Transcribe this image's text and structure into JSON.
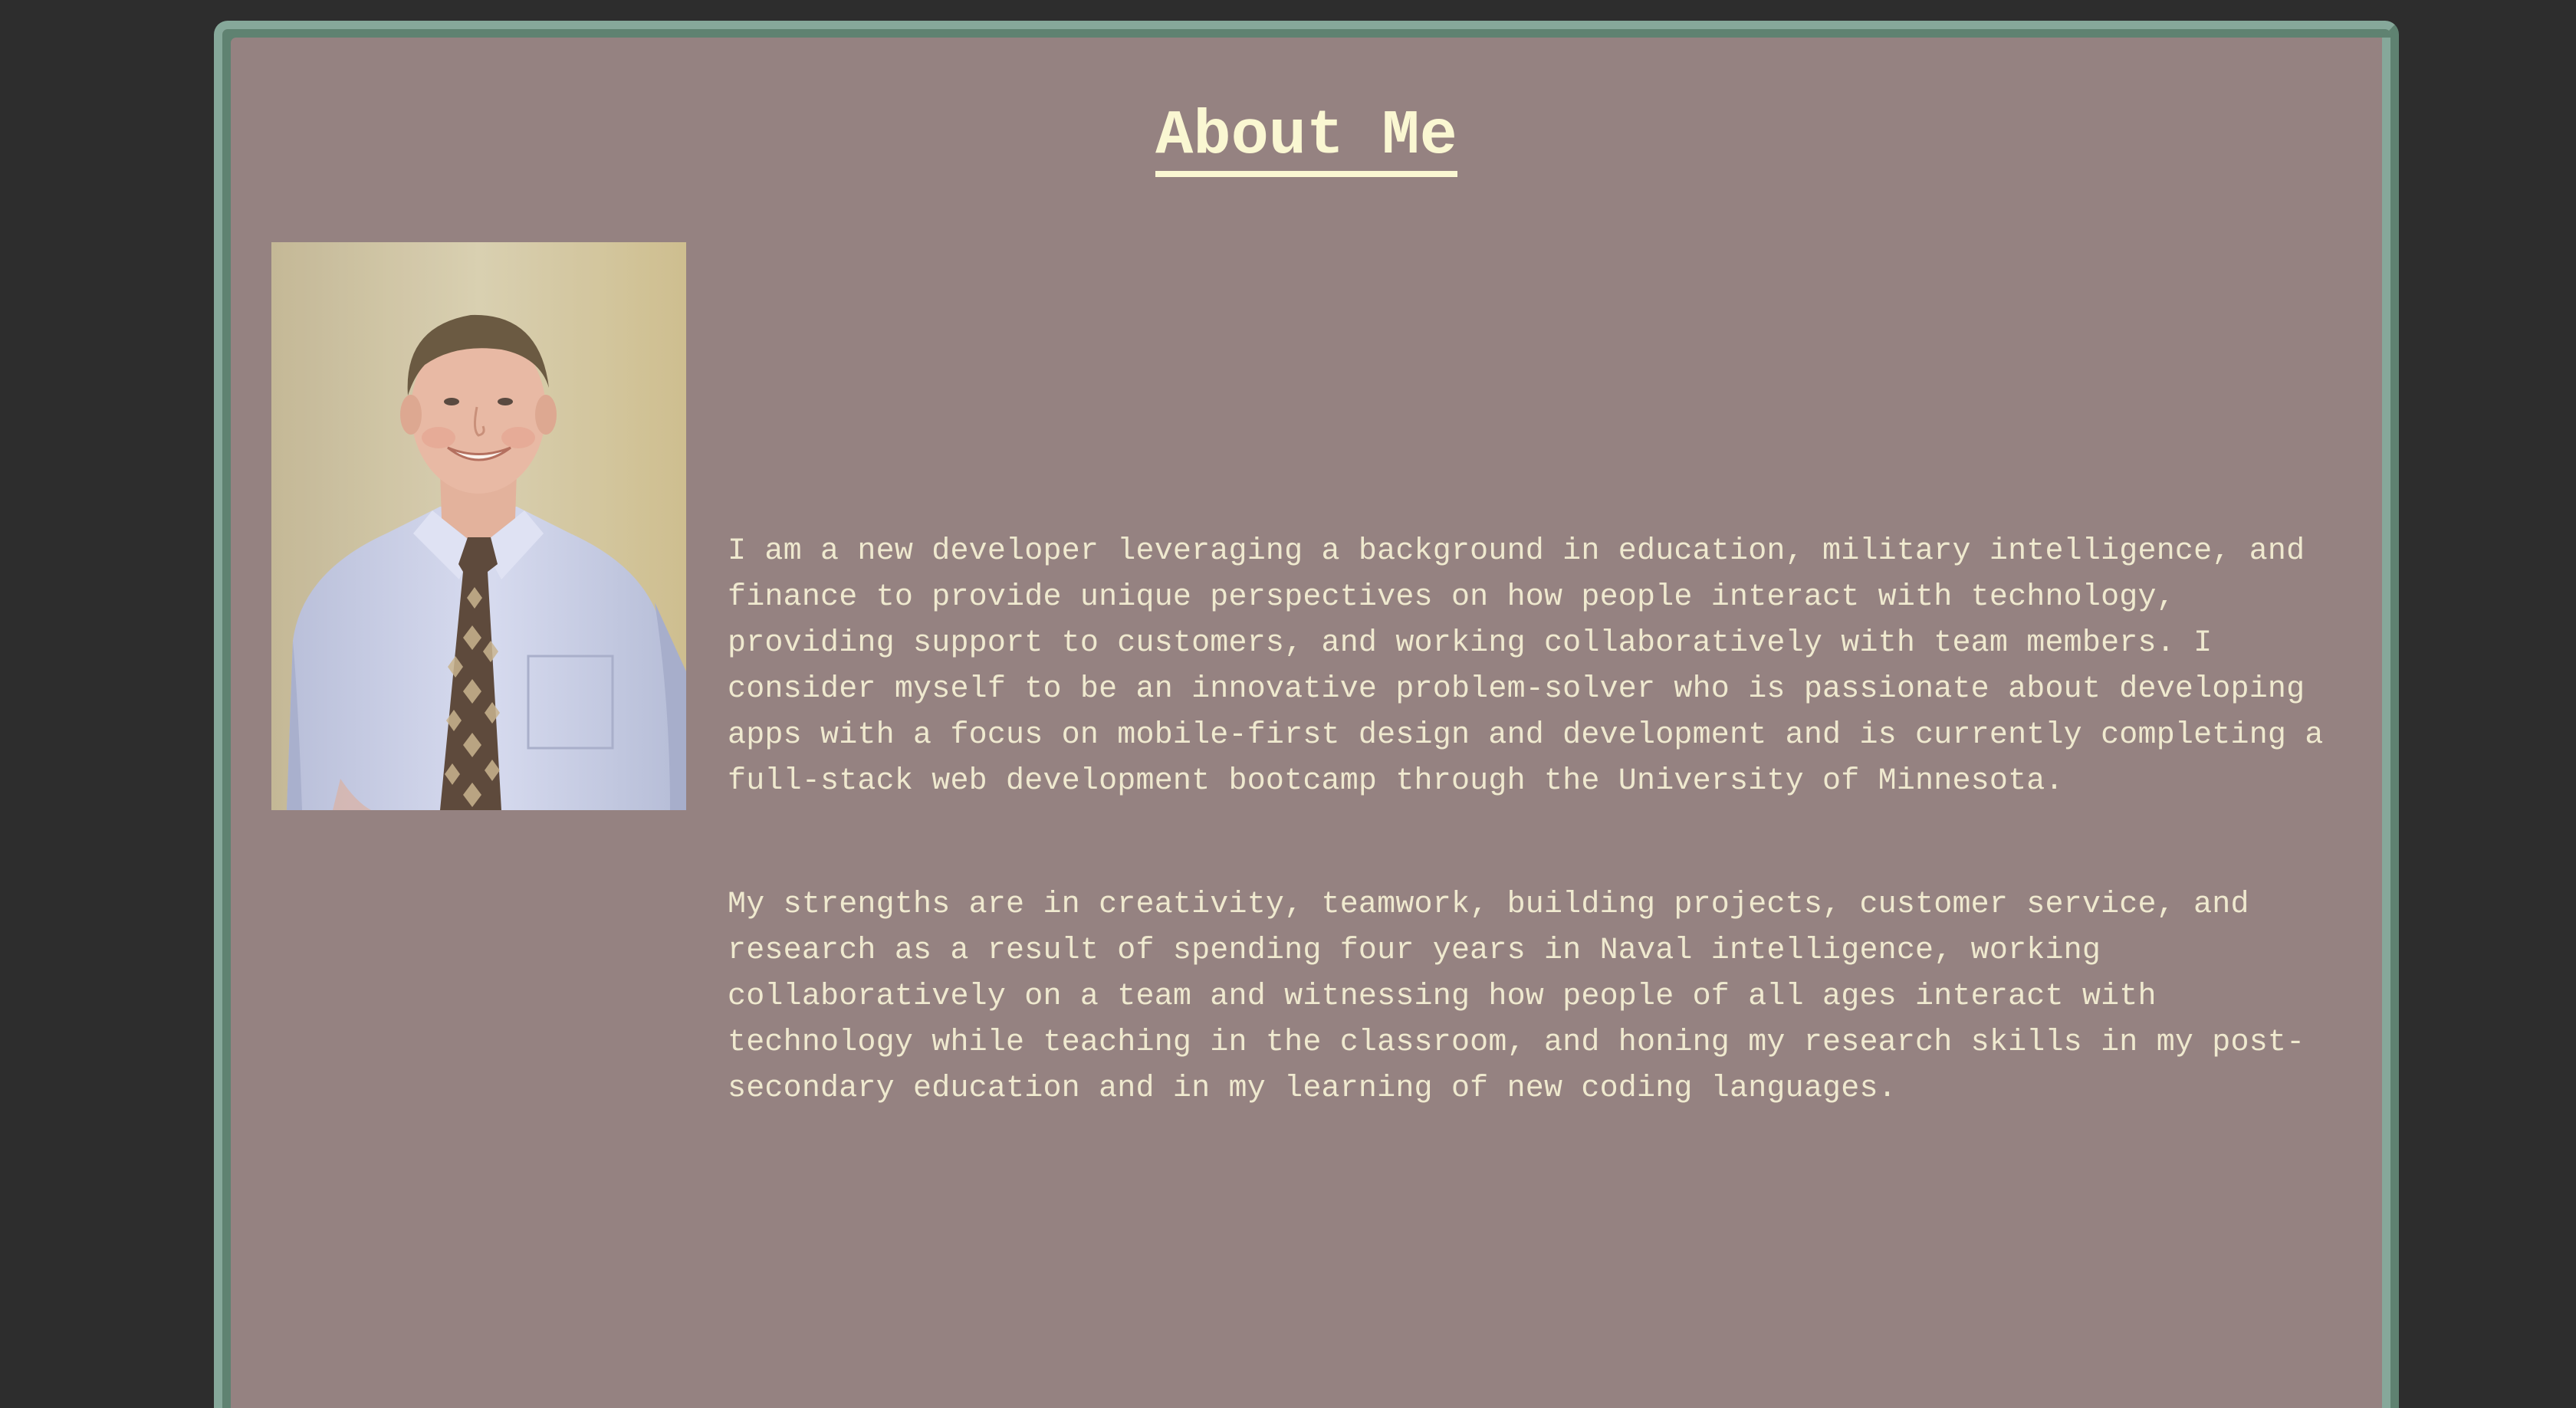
{
  "about": {
    "title": "About Me",
    "paragraph_1": "I am a new developer leveraging a background in education, military intelligence, and finance to provide unique perspectives on how people interact with technology, providing support to customers, and working collaboratively with team members. I consider myself to be an innovative problem-solver who is passionate about developing apps with a focus on mobile-first design and development and is currently completing a full-stack web development bootcamp through the University of Minnesota.",
    "paragraph_2": "My strengths are in creativity, teamwork, building projects, customer service, and research as a result of spending four years in Naval intelligence, working collaboratively on a team and witnessing how people of all ages interact with technology while teaching in the classroom, and honing my research skills in my post-secondary education and in my learning of new coding languages."
  },
  "colors": {
    "page_background": "#2d2d2d",
    "panel_background": "#958281",
    "panel_border_light": "#86a89a",
    "panel_border_dark": "#5f8271",
    "title_color": "#faf7d2",
    "text_color": "#efe9cf"
  }
}
